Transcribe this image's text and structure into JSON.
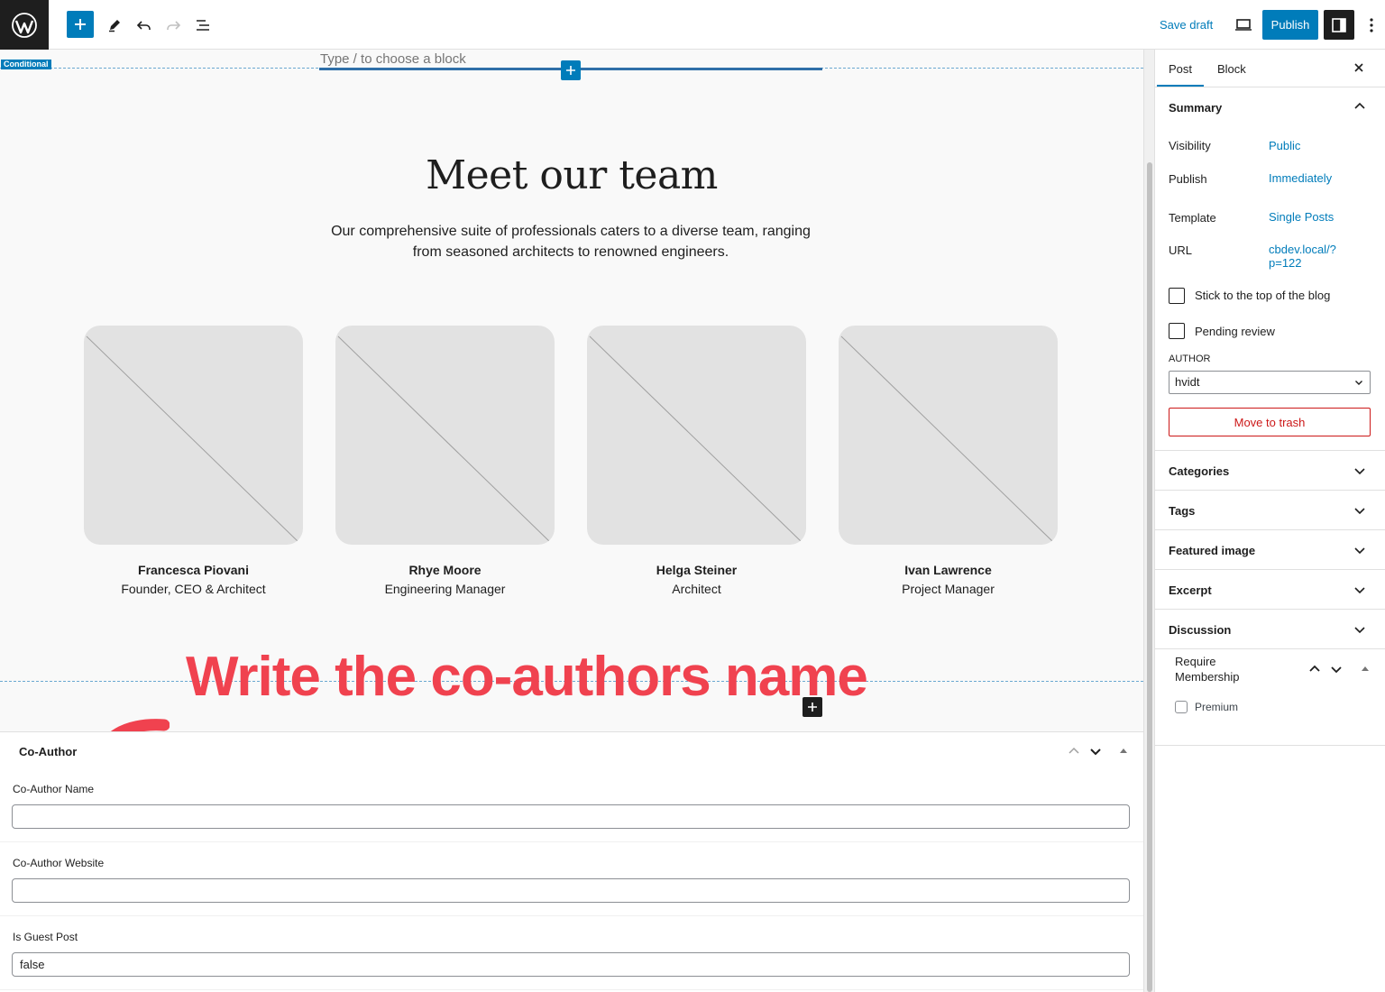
{
  "toolbar": {
    "save_draft": "Save draft",
    "publish": "Publish"
  },
  "editor": {
    "conditional_tag": "Conditional",
    "placeholder": "Type / to choose a block",
    "heading": "Meet our team",
    "intro": "Our comprehensive suite of professionals caters to a diverse team, ranging from seasoned architects to renowned engineers.",
    "team": [
      {
        "name": "Francesca Piovani",
        "role": "Founder, CEO & Architect"
      },
      {
        "name": "Rhye Moore",
        "role": "Engineering Manager"
      },
      {
        "name": "Helga Steiner",
        "role": "Architect"
      },
      {
        "name": "Ivan Lawrence",
        "role": "Project Manager"
      }
    ],
    "annotation": "Write the co-authors name"
  },
  "metabox": {
    "title": "Co-Author",
    "fields": [
      {
        "label": "Co-Author Name",
        "value": ""
      },
      {
        "label": "Co-Author Website",
        "value": ""
      },
      {
        "label": "Is Guest Post",
        "value": "false"
      }
    ]
  },
  "sidebar": {
    "tabs": [
      "Post",
      "Block"
    ],
    "summary": {
      "title": "Summary",
      "visibility_label": "Visibility",
      "visibility_value": "Public",
      "publish_label": "Publish",
      "publish_value": "Immediately",
      "template_label": "Template",
      "template_value": "Single Posts",
      "url_label": "URL",
      "url_value_1": "cbdev.local/?",
      "url_value_2": "p=122",
      "sticky_label": "Stick to the top of the blog",
      "pending_label": "Pending review",
      "author_label": "AUTHOR",
      "author_value": "hvidt",
      "trash_label": "Move to trash"
    },
    "panels": [
      "Categories",
      "Tags",
      "Featured image",
      "Excerpt",
      "Discussion"
    ],
    "membership": {
      "title_1": "Require",
      "title_2": "Membership",
      "option": "Premium"
    }
  },
  "colors": {
    "accent": "#007cba",
    "annotation": "#f0424f",
    "danger": "#cc1818"
  }
}
